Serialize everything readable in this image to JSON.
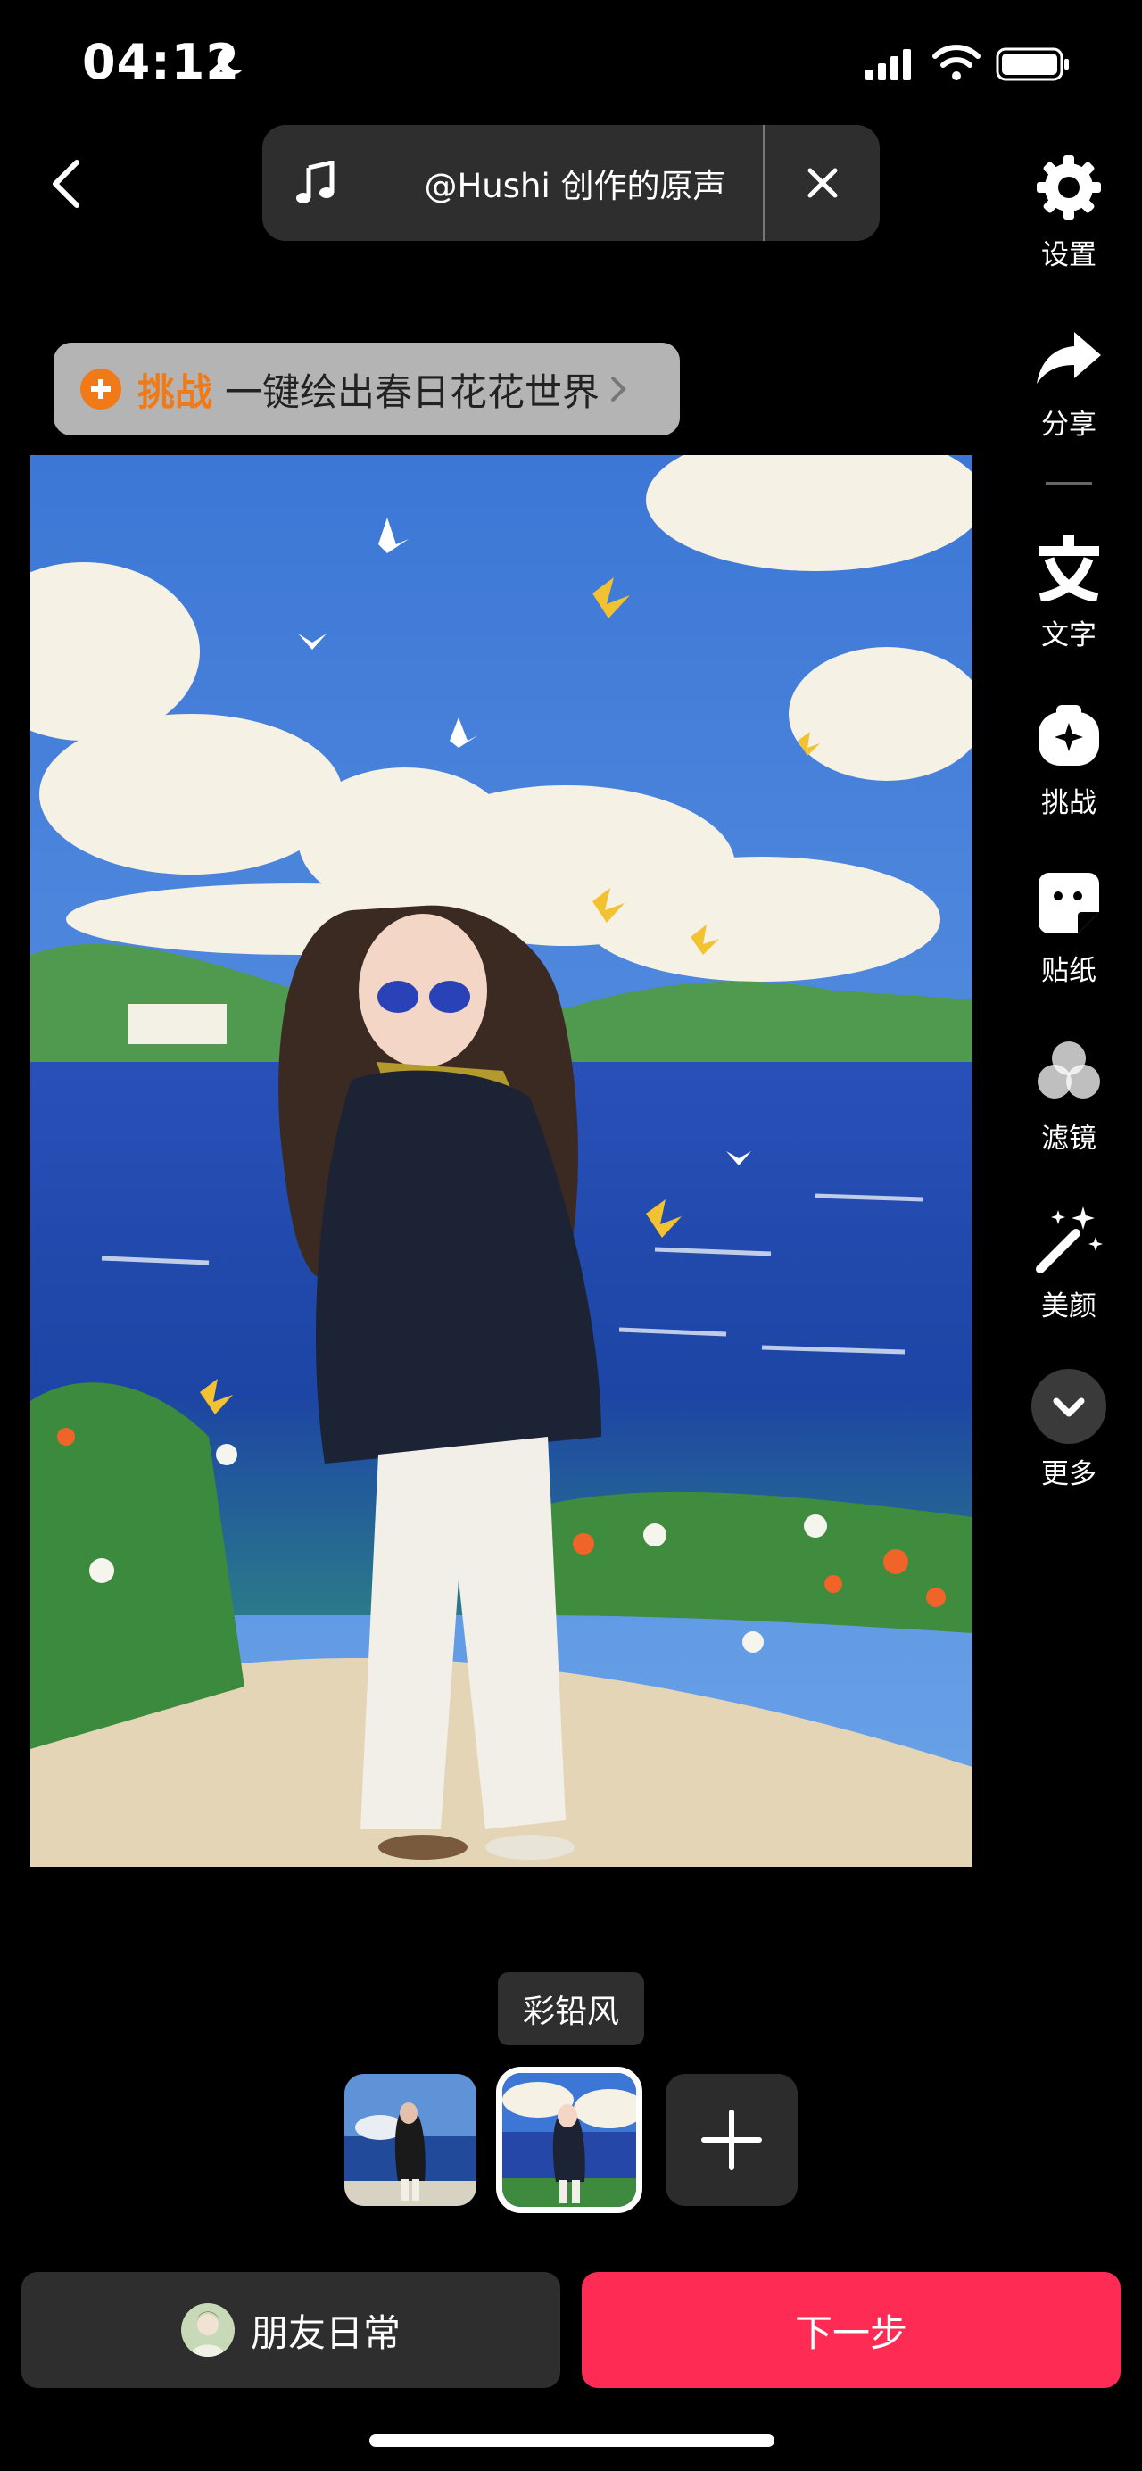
{
  "status_bar": {
    "time": "04:12",
    "icons": [
      "moon-icon",
      "signal-icon",
      "wifi-icon",
      "battery-icon"
    ]
  },
  "top_bar": {
    "back_icon": "chevron-left-icon",
    "music_icon": "music-note-icon",
    "music_title": "@Hushi 创作的原声",
    "close_icon": "close-icon"
  },
  "challenge": {
    "tag": "挑战",
    "text": "一键绘出春日花花世界",
    "accent": "#f07a18"
  },
  "toolbar": {
    "items": [
      {
        "label": "设置",
        "icon": "gear-icon"
      },
      {
        "label": "分享",
        "icon": "share-arrow-icon"
      },
      {
        "label": "文字",
        "icon": "text-icon"
      },
      {
        "label": "挑战",
        "icon": "challenge-icon"
      },
      {
        "label": "贴纸",
        "icon": "sticker-icon"
      },
      {
        "label": "滤镜",
        "icon": "filter-icon"
      },
      {
        "label": "美颜",
        "icon": "magic-wand-icon"
      },
      {
        "label": "更多",
        "icon": "chevron-down-icon"
      }
    ]
  },
  "style_label": "彩铅风",
  "bottom": {
    "friends_label": "朋友日常",
    "next_label": "下一步",
    "next_color": "#fe2c55"
  }
}
